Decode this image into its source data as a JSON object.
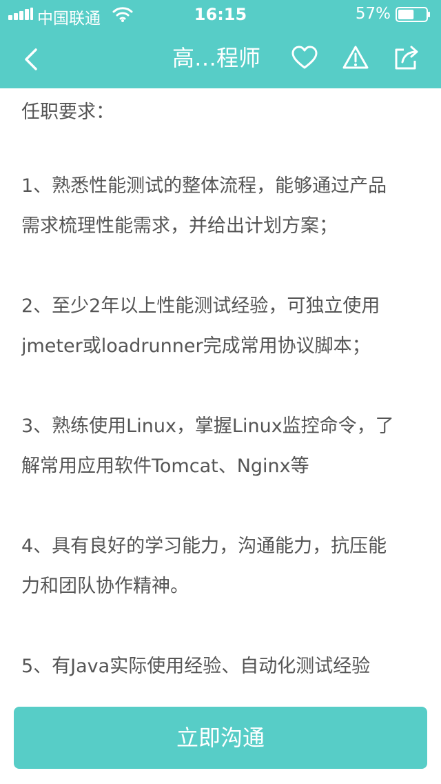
{
  "status_bar": {
    "carrier": "中国联通",
    "time": "16:15",
    "battery_percent": "57%",
    "battery_level": 0.57
  },
  "nav": {
    "title": "高…程师",
    "icons": [
      "back-icon",
      "heart-icon",
      "warning-icon",
      "share-icon"
    ]
  },
  "content": {
    "section_title": "任职要求：",
    "requirements": [
      "1、熟悉性能测试的整体流程，能够通过产品\n需求梳理性能需求，并给出计划方案；",
      "2、至少2年以上性能测试经验，可独立使用\njmeter或loadrunner完成常用协议脚本；",
      "3、熟练使用Linux，掌握Linux监控命令，了\n解常用应用软件Tomcat、Nginx等",
      "4、具有良好的学习能力，沟通能力，抗压能\n力和团队协作精神。",
      "5、有Java实际使用经验、自动化测试经验"
    ]
  },
  "cta": {
    "label": "立即沟通"
  },
  "colors": {
    "accent": "#57cdc7",
    "text": "#555555"
  }
}
